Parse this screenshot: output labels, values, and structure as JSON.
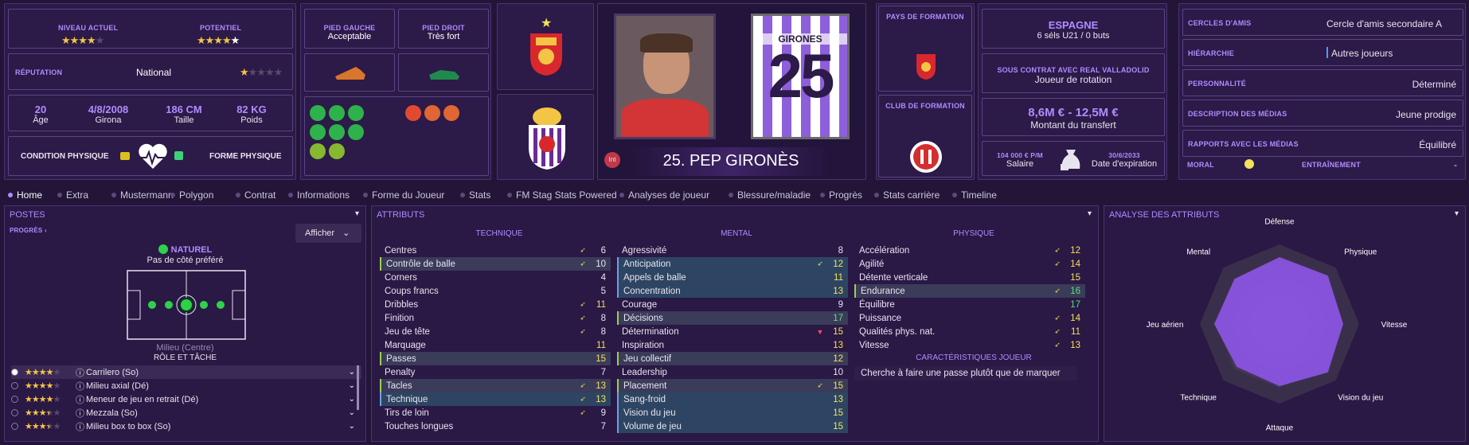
{
  "ability": {
    "current_label": "NIVEAU ACTUEL",
    "potential_label": "POTENTIEL"
  },
  "reputation": {
    "label": "RÉPUTATION",
    "value": "National"
  },
  "bio": {
    "age": "20",
    "age_label": "Âge",
    "dob": "4/8/2008",
    "city": "Girona",
    "height": "186 CM",
    "height_label": "Taille",
    "weight": "82 KG",
    "weight_label": "Poids"
  },
  "condition": {
    "condition_label": "CONDITION PHYSIQUE",
    "form_label": "FORME PHYSIQUE"
  },
  "feet": {
    "left_label": "PIED GAUCHE",
    "left_value": "Acceptable",
    "right_label": "PIED DROIT",
    "right_value": "Très fort"
  },
  "player": {
    "badge": "Int",
    "name": "25. PEP GIRONÈS",
    "shirt_name": "GIRONES",
    "shirt_number": "25"
  },
  "formation": {
    "country_label": "PAYS DE FORMATION",
    "club_label": "CLUB DE FORMATION"
  },
  "nation": {
    "name": "ESPAGNE",
    "caps": "6 séls U21 / 0 buts"
  },
  "contract": {
    "title": "SOUS CONTRAT AVEC REAL VALLADOLID",
    "role": "Joueur de rotation",
    "value": "8,6M € - 12,5M €",
    "value_label": "Montant du transfert",
    "wage": "104 000 € P/M",
    "wage_label": "Salaire",
    "expiry": "30/6/2033",
    "expiry_label": "Date d'expiration"
  },
  "info": [
    {
      "label": "CERCLES D'AMIS",
      "value": "Cercle d'amis secondaire A"
    },
    {
      "label": "HIÉRARCHIE",
      "value": "Autres joueurs"
    },
    {
      "label": "PERSONNALITÉ",
      "value": "Déterminé"
    },
    {
      "label": "DESCRIPTION DES MÉDIAS",
      "value": "Jeune prodige"
    },
    {
      "label": "RAPPORTS AVEC LES MÉDIAS",
      "value": "Équilibré"
    }
  ],
  "morale": {
    "label": "MORAL",
    "training_label": "ENTRAÎNEMENT",
    "training_value": "-"
  },
  "tabs": [
    "Home",
    "Extra",
    "Mustermann",
    "Polygon",
    "Contrat",
    "Informations",
    "Forme du Joueur",
    "Stats",
    "FM Stag Stats Powered",
    "Analyses de joueur",
    "Blessure/maladie",
    "Progrès",
    "Stats carrière",
    "Timeline"
  ],
  "positions": {
    "title": "POSTES",
    "progress": "PROGRÈS",
    "show_btn": "Afficher",
    "natural": "NATUREL",
    "side": "Pas de côté préféré",
    "position": "Milieu (Centre)",
    "role_label": "RÔLE ET TÂCHE",
    "roles": [
      {
        "name": "Carrilero (So)",
        "stars": 4
      },
      {
        "name": "Milieu axial (Dé)",
        "stars": 4
      },
      {
        "name": "Meneur de jeu en retrait (Dé)",
        "stars": 4
      },
      {
        "name": "Mezzala (So)",
        "stars": 3.5
      },
      {
        "name": "Milieu box to box (So)",
        "stars": 3.5
      }
    ]
  },
  "attributes": {
    "title": "ATTRIBUTS",
    "technical_label": "TECHNIQUE",
    "mental_label": "MENTAL",
    "physical_label": "PHYSIQUE",
    "technical": [
      {
        "name": "Centres",
        "value": "6",
        "arrow": "up"
      },
      {
        "name": "Contrôle de balle",
        "value": "10",
        "arrow": "up",
        "hl": "g"
      },
      {
        "name": "Corners",
        "value": "4"
      },
      {
        "name": "Coups francs",
        "value": "5"
      },
      {
        "name": "Dribbles",
        "value": "11",
        "arrow": "up"
      },
      {
        "name": "Finition",
        "value": "8",
        "arrow": "up"
      },
      {
        "name": "Jeu de tête",
        "value": "8",
        "arrow": "up"
      },
      {
        "name": "Marquage",
        "value": "11"
      },
      {
        "name": "Passes",
        "value": "15",
        "hl": "g"
      },
      {
        "name": "Penalty",
        "value": "7"
      },
      {
        "name": "Tacles",
        "value": "13",
        "arrow": "up",
        "hl": "g"
      },
      {
        "name": "Technique",
        "value": "13",
        "arrow": "up",
        "hl": "b"
      },
      {
        "name": "Tirs de loin",
        "value": "9",
        "arrow": "up"
      },
      {
        "name": "Touches longues",
        "value": "7"
      }
    ],
    "mental": [
      {
        "name": "Agressivité",
        "value": "8"
      },
      {
        "name": "Anticipation",
        "value": "12",
        "arrow": "up",
        "hl": "b"
      },
      {
        "name": "Appels de balle",
        "value": "11",
        "hl": "b"
      },
      {
        "name": "Concentration",
        "value": "13",
        "hl": "b"
      },
      {
        "name": "Courage",
        "value": "9"
      },
      {
        "name": "Décisions",
        "value": "17",
        "hl": "g"
      },
      {
        "name": "Détermination",
        "value": "15",
        "arrow": "down"
      },
      {
        "name": "Inspiration",
        "value": "13"
      },
      {
        "name": "Jeu collectif",
        "value": "12",
        "hl": "g"
      },
      {
        "name": "Leadership",
        "value": "10"
      },
      {
        "name": "Placement",
        "value": "15",
        "arrow": "up",
        "hl": "g"
      },
      {
        "name": "Sang-froid",
        "value": "13",
        "hl": "b"
      },
      {
        "name": "Vision du jeu",
        "value": "15",
        "hl": "b"
      },
      {
        "name": "Volume de jeu",
        "value": "15",
        "hl": "b"
      }
    ],
    "physical": [
      {
        "name": "Accélération",
        "value": "12",
        "arrow": "up"
      },
      {
        "name": "Agilité",
        "value": "14",
        "arrow": "up"
      },
      {
        "name": "Détente verticale",
        "value": "15"
      },
      {
        "name": "Endurance",
        "value": "16",
        "arrow": "up",
        "hl": "g"
      },
      {
        "name": "Équilibre",
        "value": "17"
      },
      {
        "name": "Puissance",
        "value": "14",
        "arrow": "up"
      },
      {
        "name": "Qualités phys. nat.",
        "value": "11",
        "arrow": "up"
      },
      {
        "name": "Vitesse",
        "value": "13",
        "arrow": "up"
      }
    ],
    "traits_label": "CARACTÉRISTIQUES JOUEUR",
    "trait": "Cherche à faire une passe plutôt que de marquer"
  },
  "analysis": {
    "title": "ANALYSE DES ATTRIBUTS",
    "axes": [
      "Défense",
      "Physique",
      "Vitesse",
      "Vision du jeu",
      "Attaque",
      "Technique",
      "Jeu aérien",
      "Mental"
    ]
  },
  "colors": {
    "accent": "#b08cff",
    "background": "#221538",
    "panel": "#2c1a48",
    "radar_fill": "#8e55e8"
  }
}
